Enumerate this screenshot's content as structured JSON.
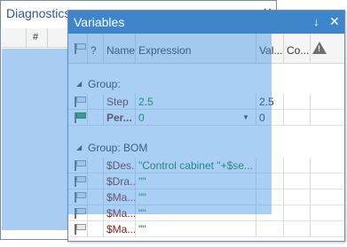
{
  "diagnostics": {
    "title": "Diagnostics",
    "column_hash": "#",
    "pin_icon": "pin-icon",
    "close_icon": "close-icon"
  },
  "variables": {
    "title": "Variables",
    "pin_glyph": "↓",
    "close_glyph": "✕",
    "columns": {
      "flag": "",
      "question": "?",
      "name": "Name",
      "expression": "Expression",
      "value": "Val...",
      "comment": "Co...",
      "warning_icon": "warning-icon"
    },
    "groups": [
      {
        "label": "Group:",
        "rows": [
          {
            "flag": "gray",
            "name": "Step",
            "expression": "2.5",
            "value": "2.5",
            "bold": false
          },
          {
            "flag": "green",
            "name": "Per...",
            "expression": "0",
            "value": "0",
            "bold": true,
            "has_dropdown": true
          }
        ]
      },
      {
        "label": "Group: BOM",
        "rows": [
          {
            "flag": "gray",
            "name": "$Des...",
            "expression": "\"Control cabinet \"+$se...",
            "value": "",
            "bold": false
          },
          {
            "flag": "gray",
            "name": "$Dra...",
            "expression": "\"\"",
            "value": "",
            "bold": false
          },
          {
            "flag": "gray",
            "name": "$Ma...",
            "expression": "\"\"",
            "value": "",
            "bold": false
          },
          {
            "flag": "gray",
            "name": "$Ma...",
            "expression": "\"\"",
            "value": "",
            "bold": false
          },
          {
            "flag": "gray",
            "name": "$Ma...",
            "expression": "\"\"",
            "value": "",
            "bold": false
          }
        ]
      }
    ]
  },
  "colors": {
    "title_bar": "#3f85c9",
    "selection_overlay": "#4096e6",
    "name_text": "#7a1c1c",
    "expression_text": "#117a2a"
  }
}
